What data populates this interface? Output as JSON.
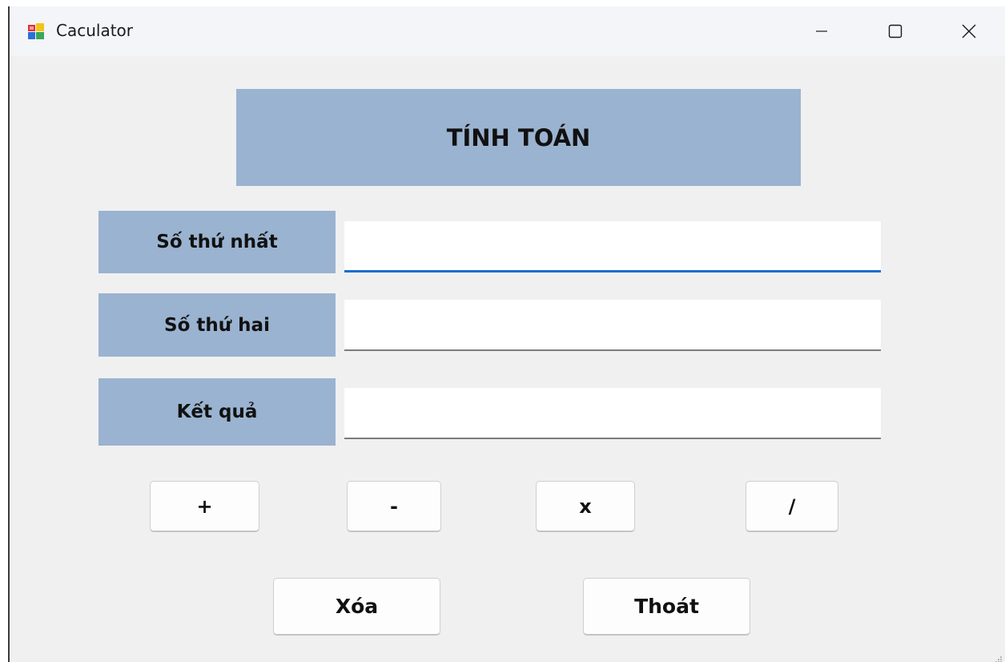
{
  "window": {
    "title": "Caculator",
    "icon": "winforms-app-icon",
    "controls": {
      "minimize_icon": "minimize-icon",
      "maximize_icon": "maximize-icon",
      "close_icon": "close-icon"
    }
  },
  "header": {
    "title": "TÍNH TOÁN"
  },
  "form": {
    "first_number": {
      "label": "Số thứ nhất",
      "value": ""
    },
    "second_number": {
      "label": "Số thứ hai",
      "value": ""
    },
    "result": {
      "label": "Kết quả",
      "value": ""
    }
  },
  "operations": [
    {
      "label": "+"
    },
    {
      "label": "-"
    },
    {
      "label": "x"
    },
    {
      "label": "/"
    }
  ],
  "actions": {
    "clear_label": "Xóa",
    "exit_label": "Thoát"
  },
  "colors": {
    "label_background": "#9ab3d0",
    "form_background": "#f0f0f0",
    "focus_accent": "#1a6fc9"
  }
}
